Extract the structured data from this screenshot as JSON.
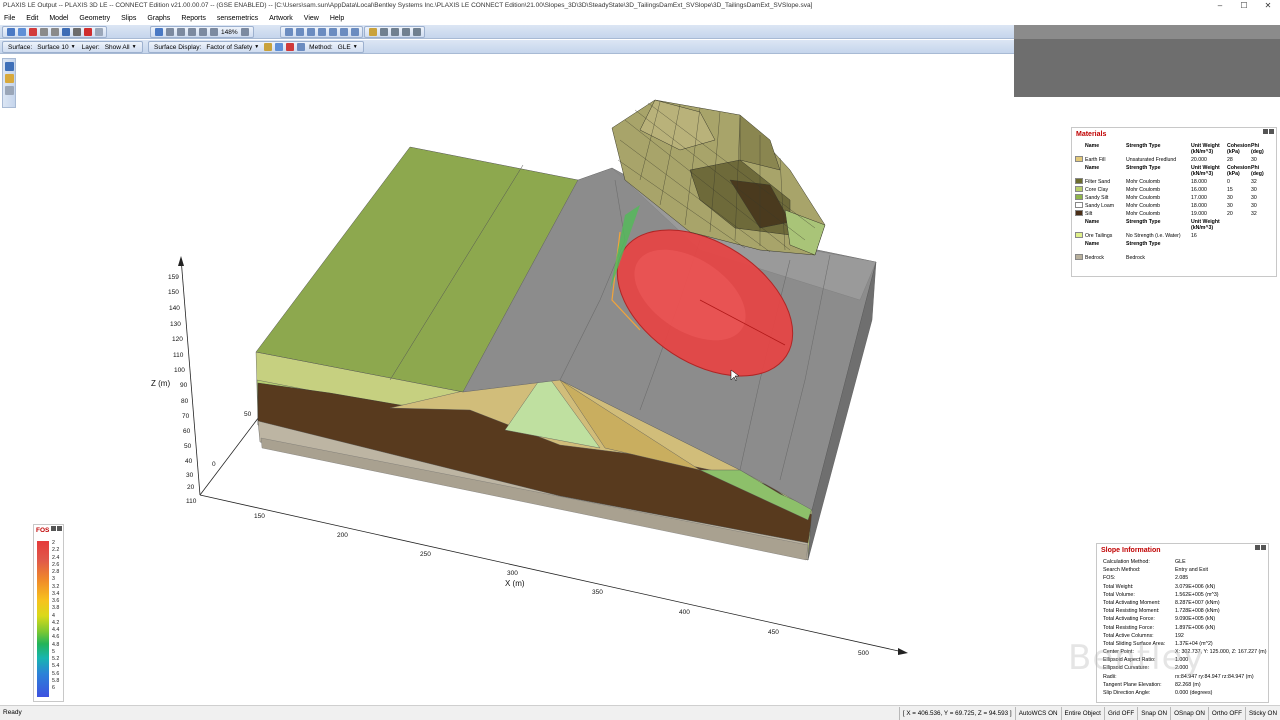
{
  "window": {
    "title": "PLAXIS LE Output -- PLAXIS 3D LE -- CONNECT Edition v21.00.00.07 -- (GSE ENABLED) -- [C:\\Users\\sam.sun\\AppData\\Local\\Bentley Systems Inc.\\PLAXIS LE CONNECT Edition\\21.00\\Slopes_3D\\3D\\SteadyState\\3D_TailingsDamExt_SVSlope\\3D_TailingsDamExt_SVSlope.sva]",
    "controls": {
      "minimize": "–",
      "maximize": "☐",
      "close": "✕"
    }
  },
  "menu": [
    "File",
    "Edit",
    "Model",
    "Geometry",
    "Slips",
    "Graphs",
    "Reports",
    "sensemetrics",
    "Artwork",
    "View",
    "Help"
  ],
  "toolbar": {
    "zoom_value": "148%",
    "surface_label": "Surface:",
    "surface_value": "Surface 10",
    "layer_label": "Layer:",
    "layer_value": "Show All",
    "surface_display_label": "Surface Display:",
    "surface_display_value": "Factor of Safety",
    "method_label": "Method:",
    "method_value": "GLE"
  },
  "axes": {
    "z_title": "Z (m)",
    "x_title": "X (m)",
    "z_ticks": [
      "159",
      "150",
      "140",
      "130",
      "120",
      "110",
      "100",
      "90",
      "80",
      "70",
      "60",
      "50",
      "40",
      "30",
      "20",
      "110"
    ],
    "x_ticks": [
      "150",
      "200",
      "250",
      "300",
      "350",
      "400",
      "450",
      "500"
    ],
    "y_ticks": [
      "50",
      "0"
    ]
  },
  "fos_legend": {
    "title": "FOS",
    "ticks": [
      "2",
      "2.2",
      "2.4",
      "2.6",
      "2.8",
      "3",
      "3.2",
      "3.4",
      "3.6",
      "3.8",
      "4",
      "4.2",
      "4.4",
      "4.6",
      "4.8",
      "5",
      "5.2",
      "5.4",
      "5.6",
      "5.8",
      "6"
    ]
  },
  "materials": {
    "title": "Materials",
    "groups": [
      {
        "header": [
          "Name",
          "Strength Type",
          "Unit Weight (kN/m^3)",
          "Cohesion (kPa)",
          "Phi (deg)"
        ],
        "rows": [
          {
            "color": "#e3c97a",
            "name": "Earth Fill",
            "type": "Unsaturated Fredlund",
            "uw": "20.000",
            "coh": "28",
            "phi": "30"
          }
        ]
      },
      {
        "header": [
          "Name",
          "Strength Type",
          "Unit Weight (kN/m^3)",
          "Cohesion (kPa)",
          "Phi (deg)"
        ],
        "rows": [
          {
            "color": "#6b6b2e",
            "name": "Filter Sand",
            "type": "Mohr Coulomb",
            "uw": "18.000",
            "coh": "0",
            "phi": "32"
          },
          {
            "color": "#b9cf6b",
            "name": "Core Clay",
            "type": "Mohr Coulomb",
            "uw": "16.000",
            "coh": "15",
            "phi": "30"
          },
          {
            "color": "#8fb54a",
            "name": "Sandy Silt",
            "type": "Mohr Coulomb",
            "uw": "17.000",
            "coh": "30",
            "phi": "30"
          },
          {
            "color": "#ffffff",
            "name": "Sandy Loam",
            "type": "Mohr Coulomb",
            "uw": "18.000",
            "coh": "30",
            "phi": "30"
          },
          {
            "color": "#4a2e16",
            "name": "Silt",
            "type": "Mohr Coulomb",
            "uw": "19.000",
            "coh": "20",
            "phi": "32"
          }
        ]
      },
      {
        "header": [
          "Name",
          "Strength Type",
          "Unit Weight (kN/m^3)",
          "",
          ""
        ],
        "rows": [
          {
            "color": "#dff08a",
            "name": "Ore Tailings",
            "type": "No Strength (i.e. Water)",
            "uw": "16",
            "coh": "",
            "phi": ""
          }
        ]
      },
      {
        "header": [
          "Name",
          "Strength Type",
          "",
          "",
          ""
        ],
        "rows": [
          {
            "color": "#b8b09c",
            "name": "Bedrock",
            "type": "Bedrock",
            "uw": "",
            "coh": "",
            "phi": ""
          }
        ]
      }
    ]
  },
  "slope_info": {
    "title": "Slope Information",
    "rows": [
      {
        "k": "Calculation Method:",
        "v": "GLE"
      },
      {
        "k": "Search Method:",
        "v": "Entry and Exit"
      },
      {
        "k": "FOS:",
        "v": "2.085"
      },
      {
        "k": "Total Weight:",
        "v": "3.079E+006 (kN)"
      },
      {
        "k": "Total Volume:",
        "v": "1.562E+005 (m^3)"
      },
      {
        "k": "Total Activating Moment:",
        "v": "8.287E+007 (kNm)"
      },
      {
        "k": "Total Resisting Moment:",
        "v": "1.728E+008 (kNm)"
      },
      {
        "k": "Total Activating Force:",
        "v": "9.090E+005 (kN)"
      },
      {
        "k": "Total Resisting Force:",
        "v": "1.897E+006 (kN)"
      },
      {
        "k": "Total Active Columns:",
        "v": "192"
      },
      {
        "k": "Total Sliding Surface Area:",
        "v": "1.37E+04 (m^2)"
      },
      {
        "k": "Center Point:",
        "v": "X: 302.737, Y: 125.000, Z: 167.227 (m)"
      },
      {
        "k": "Ellipsoid Aspect Ratio:",
        "v": "1.000"
      },
      {
        "k": "Ellipsoid Curvature:",
        "v": "2.000"
      },
      {
        "k": "Radii:",
        "v": "rx:84.947 ry:84.947 rz:84.947 (m)"
      },
      {
        "k": "Tangent Plane Elevation:",
        "v": "82.268 (m)"
      },
      {
        "k": "Slip Direction Angle:",
        "v": "0.000 (degrees)"
      }
    ]
  },
  "status": {
    "ready": "Ready",
    "coords": "[ X = 406.536, Y = 69.725, Z = 94.593 ]",
    "items": [
      "AutoWCS ON",
      "Entire Object",
      "Grid OFF",
      "Snap ON",
      "OSnap ON",
      "Ortho OFF",
      "Sticky ON"
    ]
  },
  "watermark": "Bentley"
}
